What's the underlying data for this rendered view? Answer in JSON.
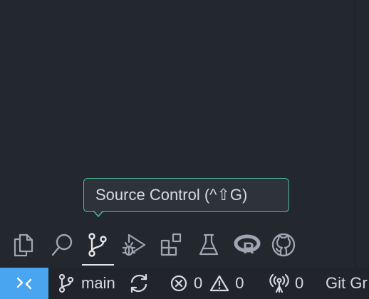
{
  "tooltip": {
    "text": "Source Control (^⇧G)"
  },
  "activity_bar": {
    "items": [
      {
        "id": "explorer",
        "icon": "files-icon"
      },
      {
        "id": "search",
        "icon": "search-icon"
      },
      {
        "id": "source-control",
        "icon": "source-control-icon",
        "active": true
      },
      {
        "id": "run-debug",
        "icon": "run-debug-icon"
      },
      {
        "id": "extensions",
        "icon": "extensions-icon"
      },
      {
        "id": "testing",
        "icon": "flask-icon"
      },
      {
        "id": "r",
        "icon": "r-logo-icon"
      },
      {
        "id": "github",
        "icon": "github-icon"
      }
    ]
  },
  "status_bar": {
    "remote_icon": "remote-icon",
    "branch": "main",
    "errors": "0",
    "warnings": "0",
    "ports": "0",
    "git_graph": "Git Gr"
  },
  "colors": {
    "background": "#23272e",
    "status_bar": "#21252b",
    "remote": "#4aa5f0",
    "tooltip_border": "#4fb9a0",
    "icon": "#a0a6b1",
    "text": "#d7dae0"
  }
}
